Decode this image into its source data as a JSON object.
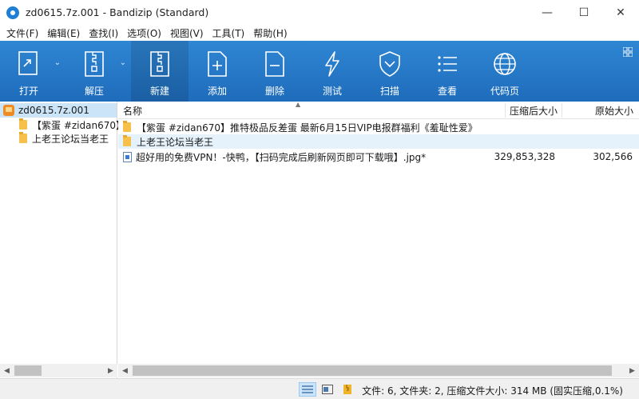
{
  "window": {
    "title": "zd0615.7z.001 - Bandizip (Standard)",
    "controls": {
      "minimize": "—",
      "maximize": "☐",
      "close": "✕"
    }
  },
  "menu": {
    "items": [
      "文件(F)",
      "编辑(E)",
      "查找(I)",
      "选项(O)",
      "视图(V)",
      "工具(T)",
      "帮助(H)"
    ]
  },
  "toolbar": {
    "open_label": "打开",
    "extract_label": "解压",
    "new_label": "新建",
    "add_label": "添加",
    "delete_label": "删除",
    "test_label": "测试",
    "scan_label": "扫描",
    "view_label": "查看",
    "codepage_label": "代码页"
  },
  "tree": {
    "root": "zd0615.7z.001",
    "children": [
      "【紫蛋 #zidan670】",
      "上老王论坛当老王"
    ]
  },
  "list": {
    "columns": {
      "name": "名称",
      "packed": "压缩后大小",
      "original": "原始大小"
    },
    "rows": [
      {
        "name": "【紫蛋 #zidan670】推特极品反差蛋 最新6月15日VIP电报群福利《羞耻性爱》",
        "packed": "",
        "original": "",
        "type": "folder"
      },
      {
        "name": "上老王论坛当老王",
        "packed": "",
        "original": "",
        "type": "folder"
      },
      {
        "name": "超好用的免费VPN！-快鸭，【扫码完成后刷新网页即可下载哦】.jpg*",
        "packed": "329,853,328",
        "original": "302,566",
        "type": "file"
      }
    ]
  },
  "status": {
    "text": "文件: 6, 文件夹: 2, 压缩文件大小: 314 MB (固实压缩,0.1%)"
  },
  "colors": {
    "toolbar": "#2a7dcc",
    "selection": "#cce4f7",
    "folder": "#f6c04a"
  }
}
